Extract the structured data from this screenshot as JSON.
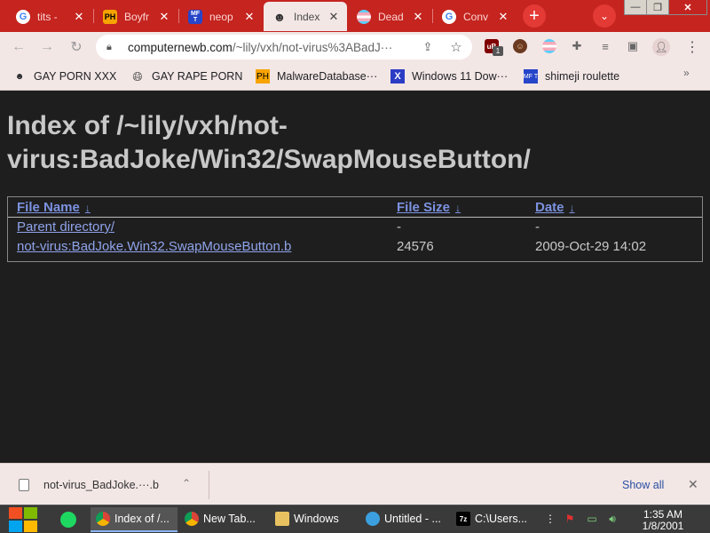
{
  "browser": {
    "tabs": [
      {
        "title": "tits -",
        "favicon": "google-icon"
      },
      {
        "title": "Boyfr",
        "favicon": "ph-icon"
      },
      {
        "title": "neop",
        "favicon": "mt-icon"
      },
      {
        "title": "Index",
        "favicon": "user-icon",
        "active": true
      },
      {
        "title": "Dead",
        "favicon": "trans-flag-icon"
      },
      {
        "title": "Conv",
        "favicon": "google-icon"
      }
    ],
    "favicon_text": {
      "ph": "PH",
      "mt": "MF T",
      "g": "G"
    },
    "window_controls": {
      "minimize": "—",
      "maximize": "❐",
      "close": "✕"
    },
    "new_tab": "+",
    "tab_search": "⌄",
    "toolbar": {
      "back": "←",
      "forward": "→",
      "reload": "↻",
      "url_host": "computernewb.com",
      "url_path": "/~lily/vxh/not-virus%3ABadJ···",
      "share_icon": "share-icon",
      "star_icon": "star-icon",
      "ublock_badge": "1"
    },
    "bookmarks": [
      {
        "label": "GAY PORN XXX",
        "icon": "user-icon"
      },
      {
        "label": "GAY RAPE PORN",
        "icon": "globe-icon"
      },
      {
        "label": "MalwareDatabase···",
        "icon": "ph-icon"
      },
      {
        "label": "Windows 11 Dow···",
        "icon": "x-icon"
      },
      {
        "label": "shimeji roulette",
        "icon": "mt-icon"
      }
    ],
    "bookmarks_more": "»"
  },
  "page": {
    "title": "Index of /~lily/vxh/not-virus:BadJoke/Win32/SwapMouseButton/",
    "columns": [
      "File Name",
      "File Size",
      "Date"
    ],
    "sort_arrow": "↓",
    "rows": [
      {
        "name": "Parent directory/",
        "size": "-",
        "date": "-"
      },
      {
        "name": "not-virus:BadJoke.Win32.SwapMouseButton.b",
        "size": "24576",
        "date": "2009-Oct-29 14:02"
      }
    ]
  },
  "download_bar": {
    "file_name": "not-virus_BadJoke.···.b",
    "chevron": "⌃",
    "show_all": "Show all",
    "close": "✕"
  },
  "taskbar": {
    "items": [
      {
        "label": "Index of /...",
        "icon": "chrome-icon",
        "active": true
      },
      {
        "label": "New Tab...",
        "icon": "chrome-icon"
      },
      {
        "label": "Windows",
        "icon": "folder-icon"
      },
      {
        "label": "Untitled - ...",
        "icon": "paint-icon"
      },
      {
        "label": "C:\\Users...",
        "icon": "7zip-icon"
      }
    ],
    "sevenzip_text": "7z",
    "clock_time": "1:35 AM",
    "clock_date": "1/8/2001"
  },
  "colors": {
    "tabstrip": "#c5241f",
    "toolbar": "#f3e7e6",
    "page_bg": "#1e1e1e",
    "link": "#7c92e0"
  }
}
